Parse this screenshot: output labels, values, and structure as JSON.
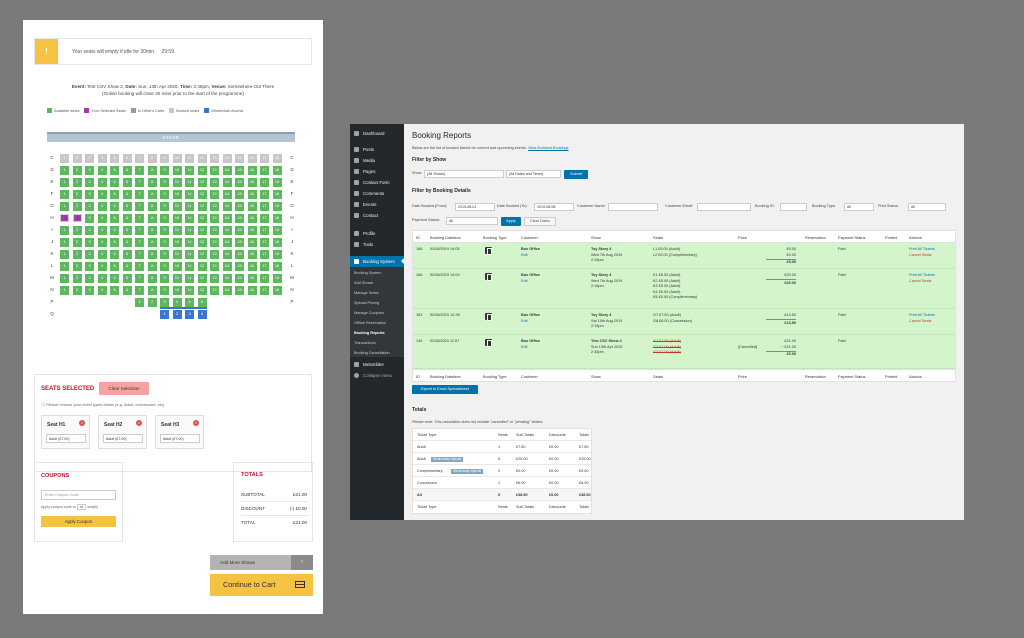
{
  "left": {
    "timer": {
      "icon": "!",
      "text": "Your seats will empty if idle for 30min.",
      "time": "29:59"
    },
    "event": {
      "event_label": "Event:",
      "event_value": "Test CSV Show 2,",
      "date_label": "Date:",
      "date_value": "Sun, 13th Apr 2025,",
      "time_label": "Time:",
      "time_value": "2:45pm,",
      "venue_label": "Venue:",
      "venue_value": "Somewhere Out There",
      "note": "(Online booking will close 30 mins prior to the start of the programme)"
    },
    "legend": [
      {
        "label": "Available seats",
        "color": "#5cb85c"
      },
      {
        "label": "Your Selected Seats",
        "color": "#a53aad"
      },
      {
        "label": "In Other's Carts",
        "color": "#9a9a9a"
      },
      {
        "label": "Booked seats",
        "color": "#c7c7c7"
      },
      {
        "label": "Wheelchair Access",
        "color": "#3a76d1"
      }
    ],
    "stage": "STAGE",
    "seat_rows": [
      {
        "row": "C",
        "seats": "oooooooooooooooooo"
      },
      {
        "row": "D",
        "seats": "aaaaaaaaaaaaaaaaaa"
      },
      {
        "row": "E",
        "seats": "aaaaaaaaaaaaaaaaaa"
      },
      {
        "row": "F",
        "seats": "aaaaaaaaaaaaaaaaaa"
      },
      {
        "row": "G",
        "seats": "aaaaaaaaaaaaaaaaaa"
      },
      {
        "row": "H",
        "seats": "ssaaaaaaaaaaaaaaaa"
      },
      {
        "row": "I",
        "seats": "aaaaaaaaaaaaaaaaaa"
      },
      {
        "row": "J",
        "seats": "aaaaaaaaaaaaaaaaaa"
      },
      {
        "row": "K",
        "seats": "aaaaaaaaaaaaaaaaaa"
      },
      {
        "row": "L",
        "seats": "aaaaaaaaaaaaaaaaaa"
      },
      {
        "row": "M",
        "seats": "aaaaaaaaaaaaaaaaaa"
      },
      {
        "row": "N",
        "seats": "aaaaaaaaaaaaaaaaaa"
      },
      {
        "row": "P",
        "seats": "      aaaaaa      "
      },
      {
        "row": "Q",
        "seats": "        wwww      "
      }
    ],
    "seats_selected": {
      "title": "SEATS SELECTED",
      "clear": "Clear Selection",
      "note": "Please choose your ticket types below (e.g. Adult, concession, etc).",
      "cards": [
        {
          "name": "Seat H1",
          "option": "Adult (£7.00)"
        },
        {
          "name": "Seat H2",
          "option": "Adult (£7.00)"
        },
        {
          "name": "Seat H3",
          "option": "Adult (£7.00)"
        }
      ]
    },
    "coupons": {
      "title": "COUPONS",
      "placeholder": "Enter Coupon Code",
      "note": "Apply coupon code to",
      "count": "all",
      "note_suffix": "seat(s)",
      "button": "Apply Coupon"
    },
    "totals": {
      "title": "TOTALS",
      "subtotal_label": "SUBTOTAL",
      "subtotal": "£21.00",
      "discount_label": "DISCOUNT",
      "discount": "(-) £0.00",
      "total_label": "TOTAL",
      "total": "£21.00"
    },
    "add_more": "Add More Shows",
    "continue": "Continue to Cart"
  },
  "wp": {
    "menu": [
      "Dashboard",
      "Posts",
      "Media",
      "Pages",
      "Contact Form",
      "Comments",
      "Events",
      "Contact",
      "Profile",
      "Tools",
      "Booking System"
    ],
    "submenu": [
      "Booking System",
      "Add Shows",
      "Manage Seats",
      "Special Pricing",
      "Manage Coupons",
      "Offline Reservation",
      "Booking Reports",
      "Transactions",
      "Booking Cancellation"
    ],
    "menu_after": [
      "MetaSlider",
      "Collapse menu"
    ],
    "title": "Booking Reports",
    "desc": "Below are the list of booked tickets for current and upcoming events.",
    "desc_link": "View Archived Bookings",
    "filter_show": {
      "heading": "Filter by Show",
      "show_label": "Show",
      "show_value": "(All Shows)",
      "dates_value": "(All Dates and Times)",
      "submit": "Submit"
    },
    "filter_details": {
      "heading": "Filter by Booking Details",
      "date_from_label": "Date Booked (From):",
      "date_from": "2019-08-01",
      "date_to_label": "Date Booked (To):",
      "date_to": "2019-08-06",
      "customer_name_label": "Customer Name:",
      "customer_email_label": "Customer Email:",
      "booking_id_label": "Booking ID:",
      "booking_type_label": "Booking Type:",
      "booking_type": "All",
      "print_status_label": "Print Status:",
      "print_status": "All",
      "payment_status_label": "Payment Status:",
      "payment_status": "All",
      "apply": "Apply",
      "clear": "Clear Dates"
    },
    "columns": [
      "ID",
      "Booking Datetime",
      "Booking Type",
      "Customer",
      "Show",
      "Seats",
      "Price",
      "Reservation",
      "Payment Status",
      "Printed",
      "Actions"
    ],
    "rows": [
      {
        "id": "168",
        "datetime": "02/08/2019 14:05",
        "customer": "Box Office",
        "edit": "Edit",
        "show": "Toy Story 4",
        "show_date": "Wed 7th Aug 2019",
        "show_time": "2:15pm",
        "seats": [
          "L1  £5.00 (Adult)",
          "L2  £0.00 (Complimentary)"
        ],
        "prices": [
          "£5.00",
          "£0.00"
        ],
        "total": "£5.00",
        "payment": "Paid",
        "print": "Print All Tickets",
        "cancel": "Cancel Seats"
      },
      {
        "id": "166",
        "datetime": "02/08/2019 14:00",
        "customer": "Box Office",
        "edit": "Edit",
        "show": "Toy Story 4",
        "show_date": "Wed 7th Aug 2019",
        "show_time": "2:15pm",
        "seats": [
          "K1  £5.00 (Adult)",
          "K2  £5.00 (Adult)",
          "K3  £5.00 (Adult)",
          "K4  £5.00 (Adult)",
          "K5  £0.00 (Complimentary)"
        ],
        "prices": [
          "£20.00"
        ],
        "total": "£20.00",
        "payment": "Paid",
        "print": "Print All Tickets",
        "cancel": "Cancel Seats"
      },
      {
        "id": "163",
        "datetime": "02/08/2019 12:28",
        "customer": "Box Office",
        "edit": "Edit",
        "show": "Toy Story 4",
        "show_date": "Sat 10th Aug 2019",
        "show_time": "2:15pm",
        "seats": [
          "G7  £7.50 (Adult)",
          "G8  £6.00 (Concession)"
        ],
        "prices": [
          "£13.50"
        ],
        "total": "£13.50",
        "payment": "Paid",
        "print": "Print All Tickets",
        "cancel": "Cancel Seats"
      },
      {
        "id": "149",
        "datetime": "02/08/2019 11:57",
        "customer": "Box Office",
        "edit": "Edit",
        "show": "Test CSV Show 2",
        "show_date": "Sun 13th Apr 2025",
        "show_time": "2:45pm",
        "seats": [
          "G1  £7.00 (Adult)",
          "G2  £7.00 (Adult)",
          "G3  £7.00 (Adult)"
        ],
        "prices": [
          "£21.00"
        ],
        "cancelled_label": "[Cancelled]",
        "cancelled_amount": "− £21.00",
        "total": "£0.00",
        "payment": "Paid",
        "print": "",
        "cancel": ""
      }
    ],
    "export": "Export to Excel Spreadsheet",
    "totals": {
      "heading": "Totals",
      "note": "Please note: This calculation does not include \"cancelled\" or \"pending\" tickets.",
      "columns": [
        "Ticket Type",
        "Seats",
        "Sub-Totals",
        "Discounts",
        "Totals"
      ],
      "rows": [
        {
          "type": "Adult",
          "badge": "",
          "seats": "1",
          "sub": "£7.50",
          "disc": "£0.00",
          "tot": "£7.50"
        },
        {
          "type": "Adult",
          "badge": "Wednesday Special",
          "seats": "5",
          "sub": "£25.00",
          "disc": "£0.00",
          "tot": "£25.00"
        },
        {
          "type": "Complimentary",
          "badge": "Wednesday Special",
          "seats": "2",
          "sub": "£0.00",
          "disc": "£0.00",
          "tot": "£0.00"
        },
        {
          "type": "Concession",
          "badge": "",
          "seats": "1",
          "sub": "£6.00",
          "disc": "£0.00",
          "tot": "£6.00"
        }
      ],
      "all": {
        "type": "All",
        "seats": "9",
        "sub": "£38.50",
        "disc": "£0.00",
        "tot": "£38.50"
      }
    }
  }
}
